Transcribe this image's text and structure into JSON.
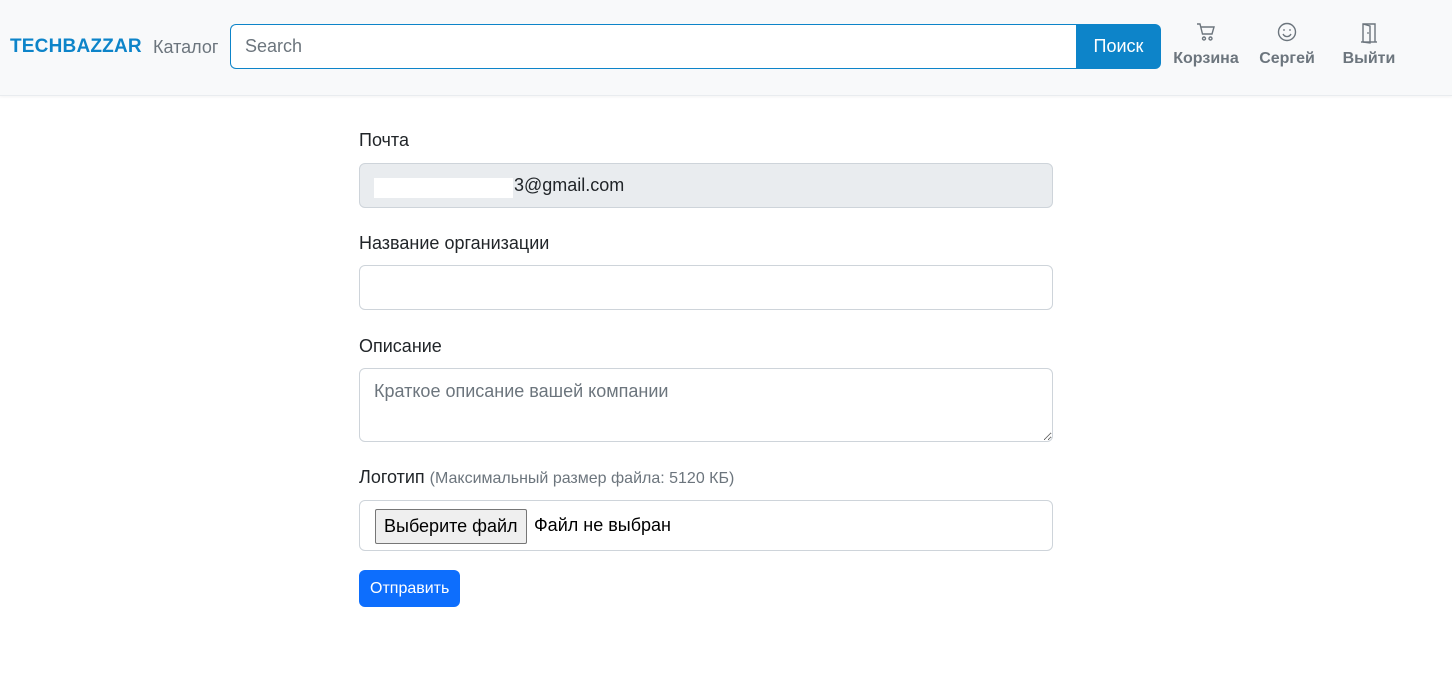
{
  "navbar": {
    "brand": "TECHBAZZAR",
    "catalog_link": "Каталог",
    "search": {
      "placeholder": "Search",
      "value": "",
      "button_label": "Поиск"
    },
    "cart": {
      "label": "Корзина",
      "icon": "cart-icon"
    },
    "user": {
      "label": "Сергей",
      "icon": "smiley-icon"
    },
    "logout": {
      "label": "Выйти",
      "icon": "door-icon"
    }
  },
  "form": {
    "email": {
      "label": "Почта",
      "value_visible_suffix": "3@gmail.com"
    },
    "organization": {
      "label": "Название организации",
      "value": ""
    },
    "description": {
      "label": "Описание",
      "placeholder": "Краткое описание вашей компании"
    },
    "logo": {
      "label": "Логотип",
      "hint": "(Максимальный размер файла: 5120 КБ)",
      "choose_button": "Выберите файл",
      "file_status": "Файл не выбран"
    },
    "submit_label": "Отправить"
  },
  "colors": {
    "brand": "#0d84c9",
    "primary": "#0d6efd",
    "navbar_bg": "#f8f9fa",
    "muted": "#6c757d",
    "readonly_bg": "#e9ecef"
  }
}
